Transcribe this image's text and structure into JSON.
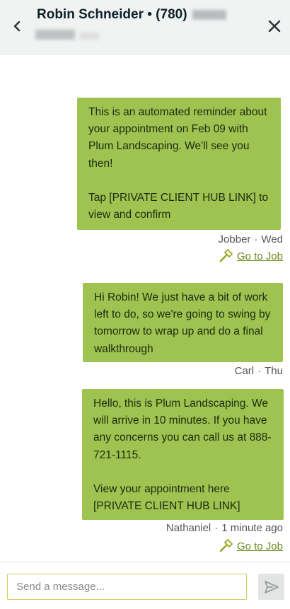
{
  "header": {
    "title": "Robin Schneider • (780)",
    "back_icon": "chevron-left-icon",
    "close_icon": "close-icon"
  },
  "messages": [
    {
      "text": "This is an automated reminder about your appointment on Feb 09 with Plum Landscaping. We'll see you then!\n\nTap [PRIVATE CLIENT HUB LINK] to view and confirm",
      "sender": "Jobber",
      "time": "Wed",
      "link_label": "Go to Job"
    },
    {
      "text": "Hi Robin! We just have a bit of work left to do, so we're going to swing by tomorrow to wrap up and do a final walkthrough",
      "sender": "Carl",
      "time": "Thu"
    },
    {
      "text": "Hello, this is Plum Landscaping. We will arrive in 10 minutes. If you have any concerns you can call us at 888-721-1115.\n\nView your appointment here [PRIVATE CLIENT HUB LINK]",
      "sender": "Nathaniel",
      "time": "1 minute ago",
      "link_label": "Go to Job"
    }
  ],
  "meta_separator": "·",
  "composer": {
    "placeholder": "Send a message..."
  },
  "colors": {
    "bubble": "#9ec350",
    "link": "#6a8a1c",
    "header_bg": "#f1f2f2"
  }
}
